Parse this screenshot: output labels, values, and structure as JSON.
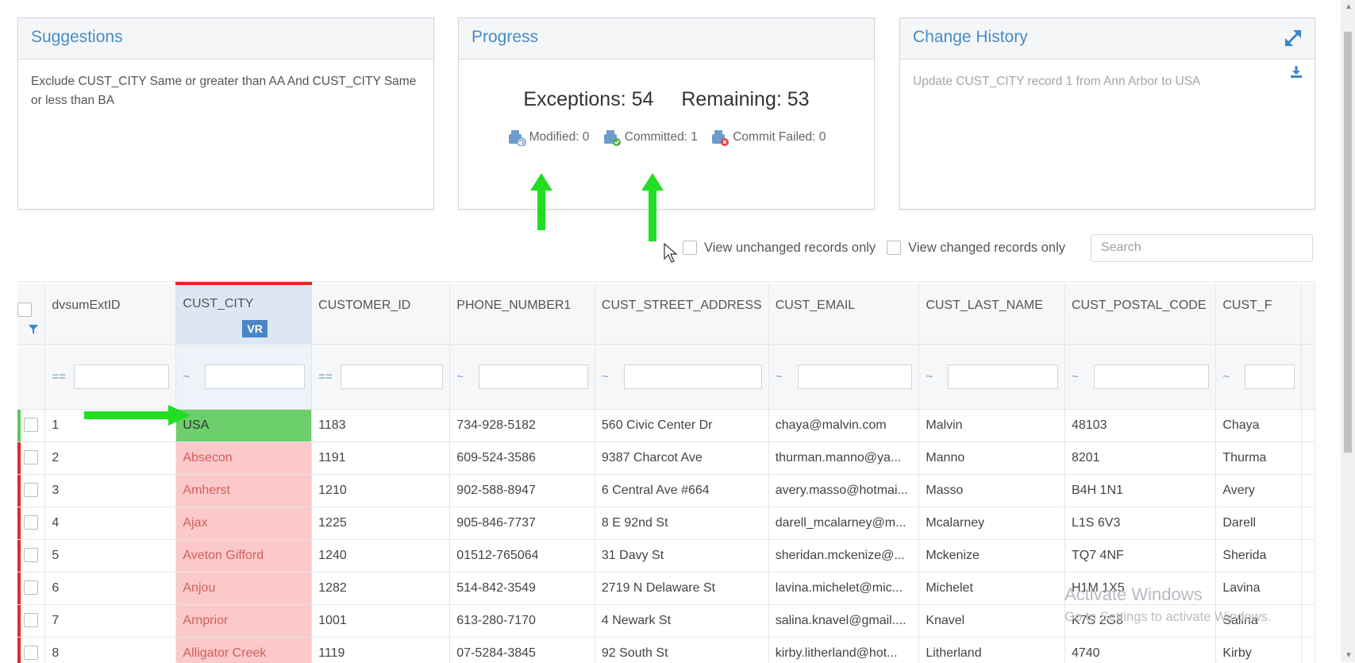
{
  "suggestions": {
    "title": "Suggestions",
    "text": "Exclude CUST_CITY Same or greater than AA And CUST_CITY Same or less than BA"
  },
  "progress": {
    "title": "Progress",
    "exceptions_label": "Exceptions: 54",
    "remaining_label": "Remaining: 53",
    "modified_label": "Modified: 0",
    "committed_label": "Committed: 1",
    "failed_label": "Commit Failed: 0"
  },
  "history": {
    "title": "Change History",
    "entry": "Update CUST_CITY record 1 from Ann Arbor to USA"
  },
  "toolbar": {
    "unchanged_label": "View unchanged records only",
    "changed_label": "View changed records only",
    "search_placeholder": "Search"
  },
  "grid": {
    "columns": [
      "dvsumExtID",
      "CUST_CITY",
      "CUSTOMER_ID",
      "PHONE_NUMBER1",
      "CUST_STREET_ADDRESS",
      "CUST_EMAIL",
      "CUST_LAST_NAME",
      "CUST_POSTAL_CODE",
      "CUST_F"
    ],
    "vr_badge": "VR",
    "filter_ops": [
      "==",
      "~",
      "==",
      "~",
      "~",
      "~",
      "~",
      "~",
      "~"
    ],
    "rows": [
      [
        "1",
        "USA",
        "1183",
        "734-928-5182",
        "560 Civic Center Dr",
        "chaya@malvin.com",
        "Malvin",
        "48103",
        "Chaya"
      ],
      [
        "2",
        "Absecon",
        "1191",
        "609-524-3586",
        "9387 Charcot Ave",
        "thurman.manno@ya...",
        "Manno",
        "8201",
        "Thurma"
      ],
      [
        "3",
        "Amherst",
        "1210",
        "902-588-8947",
        "6 Central Ave #664",
        "avery.masso@hotmai...",
        "Masso",
        "B4H 1N1",
        "Avery"
      ],
      [
        "4",
        "Ajax",
        "1225",
        "905-846-7737",
        "8 E 92nd St",
        "darell_mcalarney@m...",
        "Mcalarney",
        "L1S 6V3",
        "Darell"
      ],
      [
        "5",
        "Aveton Gifford",
        "1240",
        "01512-765064",
        "31 Davy St",
        "sheridan.mckenize@...",
        "Mckenize",
        "TQ7 4NF",
        "Sherida"
      ],
      [
        "6",
        "Anjou",
        "1282",
        "514-842-3549",
        "2719 N Delaware St",
        "lavina.michelet@mic...",
        "Michelet",
        "H1M 1X5",
        "Lavina"
      ],
      [
        "7",
        "Arnprior",
        "1001",
        "613-280-7170",
        "4 Newark St",
        "salina.knavel@gmail....",
        "Knavel",
        "K7S 2G8",
        "Salina"
      ],
      [
        "8",
        "Alligator Creek",
        "1119",
        "07-5284-3845",
        "92 South St",
        "kirby.litherland@hot...",
        "Litherland",
        "4740",
        "Kirby"
      ]
    ],
    "row_status": [
      "ok",
      "bad",
      "bad",
      "bad",
      "bad",
      "bad",
      "bad",
      "bad"
    ]
  },
  "watermark": {
    "line1": "Activate Windows",
    "line2": "Go to Settings to activate Windows."
  },
  "colors": {
    "accent": "#4a8bc2",
    "valid": "#6ccf6c",
    "invalid_bg": "#fbc9c9",
    "invalid_text": "#d35d5d",
    "annotation_arrow": "#22dd22"
  }
}
